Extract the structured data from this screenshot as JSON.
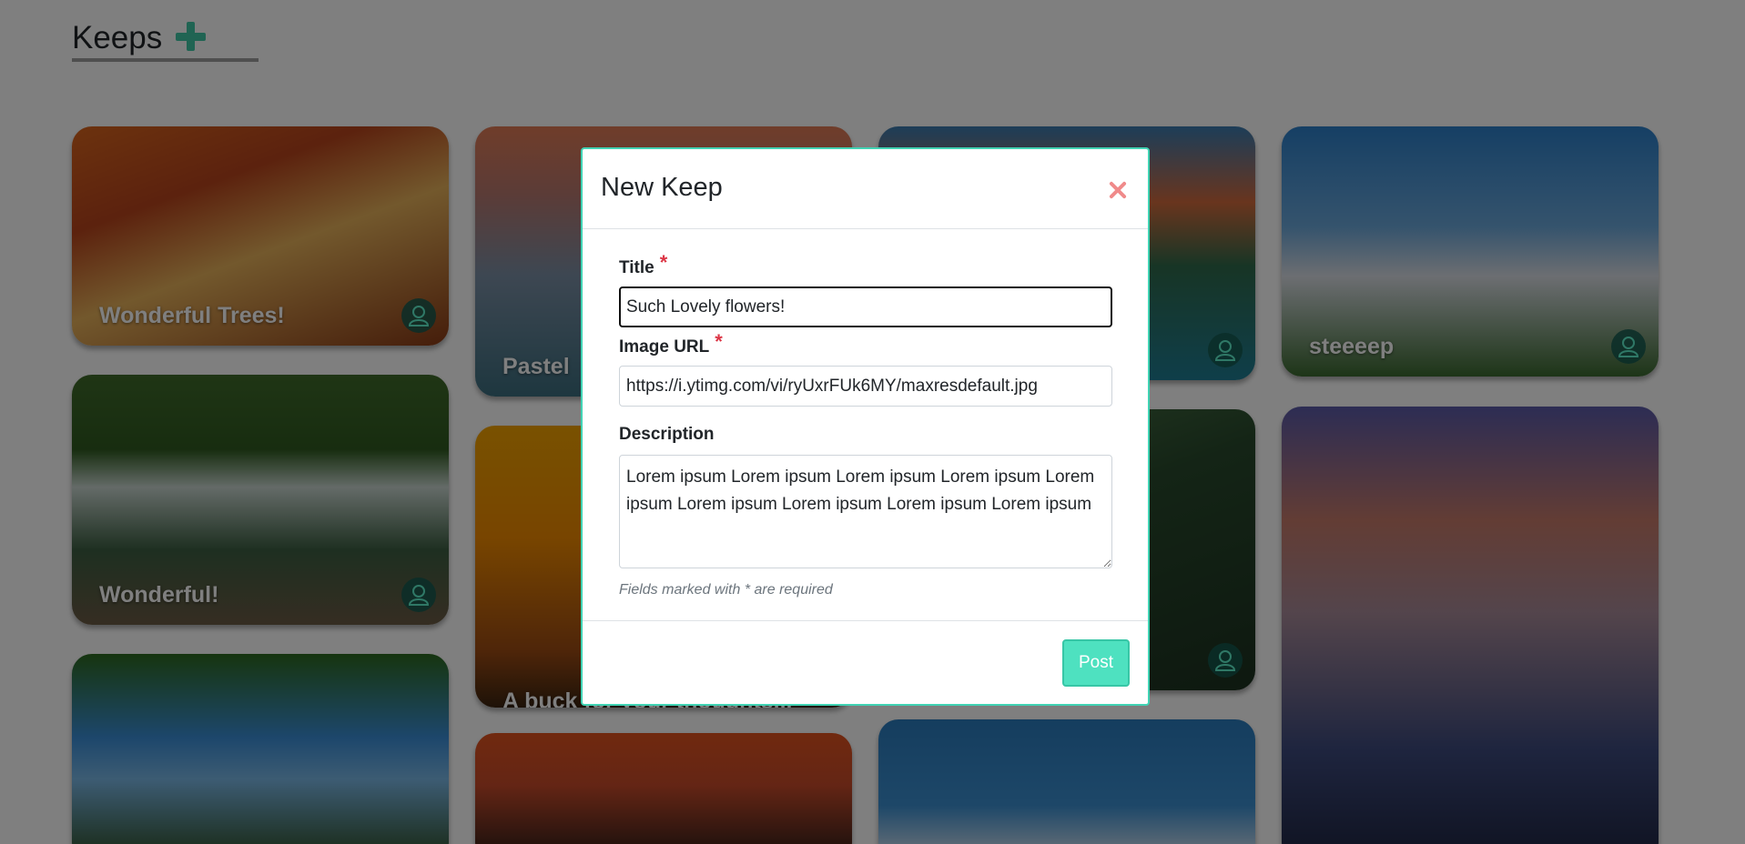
{
  "header": {
    "title": "Keeps",
    "add_icon": "plus-icon"
  },
  "cards": [
    {
      "label": "Wonderful Trees!",
      "icon": "user-avatar-icon"
    },
    {
      "label": "Pastel",
      "icon": "user-avatar-icon"
    },
    {
      "label": "",
      "icon": "user-avatar-icon"
    },
    {
      "label": "steeeep",
      "icon": "user-avatar-icon"
    },
    {
      "label": "Wonderful!",
      "icon": "user-avatar-icon"
    },
    {
      "label": "A buck for your thoughts...",
      "icon": "user-avatar-icon"
    },
    {
      "label": "",
      "icon": "user-avatar-icon"
    },
    {
      "label": "",
      "icon": "user-avatar-icon"
    },
    {
      "label": "",
      "icon": "user-avatar-icon"
    },
    {
      "label": "",
      "icon": "user-avatar-icon"
    },
    {
      "label": "",
      "icon": "user-avatar-icon"
    }
  ],
  "modal": {
    "title": "New Keep",
    "close_icon": "close-icon",
    "fields": {
      "title": {
        "label": "Title",
        "required_mark": "*",
        "value": "Such Lovely flowers!"
      },
      "image_url": {
        "label": "Image URL",
        "required_mark": "*",
        "value": "https://i.ytimg.com/vi/ryUxrFUk6MY/maxresdefault.jpg"
      },
      "description": {
        "label": "Description",
        "value": "Lorem ipsum Lorem ipsum Lorem ipsum Lorem ipsum Lorem ipsum Lorem ipsum Lorem ipsum Lorem ipsum Lorem ipsum"
      }
    },
    "hint": "Fields marked with * are required",
    "post_label": "Post"
  },
  "colors": {
    "accent": "#41d3b4",
    "button": "#4ee1c0",
    "required": "#dc3545",
    "close": "#f08a8a"
  }
}
